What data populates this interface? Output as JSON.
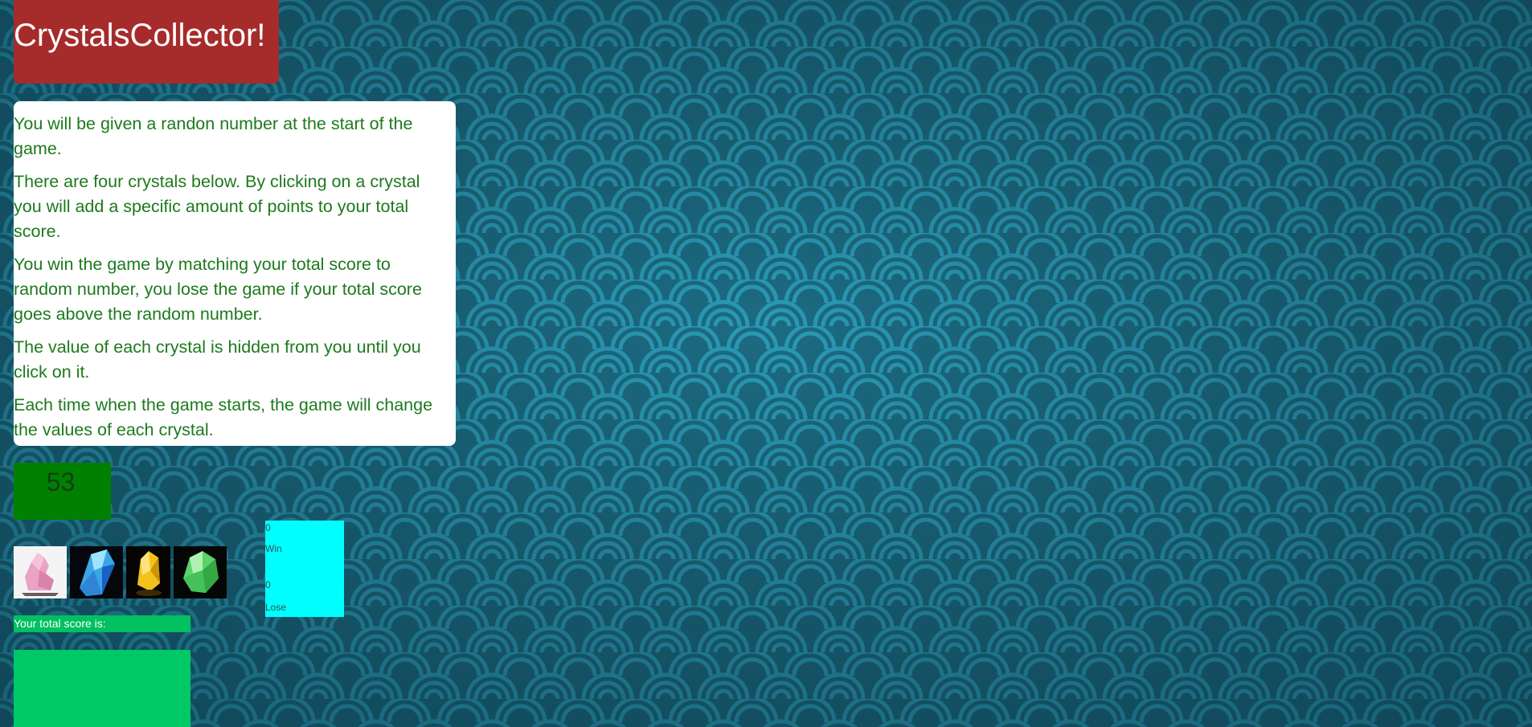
{
  "game": {
    "title": "CrystalsCollector!"
  },
  "instructions": [
    "You will be given a randon number at the start of the game.",
    "There are four crystals below. By clicking on a crystal you will add a specific amount of points to your total score.",
    "You win the game by matching your total score to random number, you lose the game if your total score goes above the random number.",
    "The value of each crystal is hidden from you until you click on it.",
    "Each time when the game starts, the game will change the values of each crystal."
  ],
  "target": {
    "number": "53"
  },
  "crystals": [
    {
      "icon": "pink-crystal-icon",
      "color": "#e9a3c4"
    },
    {
      "icon": "blue-crystal-icon",
      "color": "#3aa6e8"
    },
    {
      "icon": "yellow-crystal-icon",
      "color": "#f2c21b"
    },
    {
      "icon": "green-crystal-icon",
      "color": "#59d26a"
    }
  ],
  "score": {
    "label": "Your total score is:",
    "value": ""
  },
  "record": {
    "wins": "0",
    "win_label": "Win",
    "losses": "0",
    "lose_label": "Lose"
  },
  "colors": {
    "title_bg": "#a62b2b",
    "instructions_text": "#1d7a1d",
    "target_bg": "#008000",
    "score_bg": "#00c866",
    "record_bg": "#00ffff",
    "background": "#1d6f86"
  }
}
